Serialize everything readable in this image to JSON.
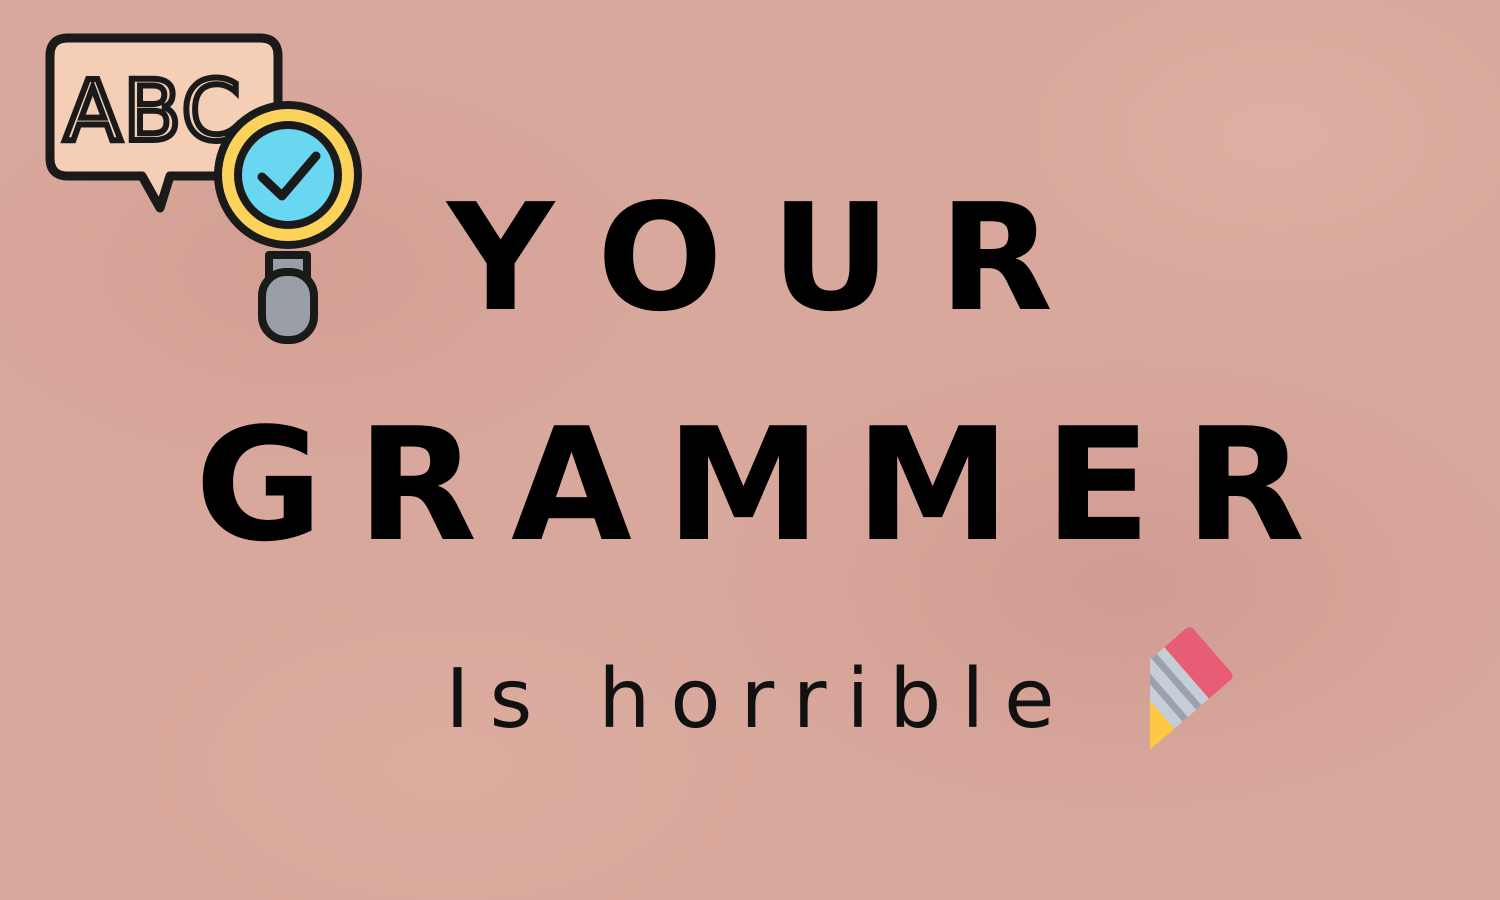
{
  "poster": {
    "line1": "YOUR",
    "line2": "GRAMMER",
    "line3": "Is horrible"
  },
  "icons": {
    "grammar_check": {
      "name": "abc-grammar-check-icon",
      "label": "ABC"
    },
    "pencil": {
      "name": "pencil-icon"
    }
  },
  "colors": {
    "background": "#d9a89c",
    "text": "#000000",
    "speech_bubble_fill": "#f4cfb6",
    "magnifier_ring": "#fcd35a",
    "magnifier_glass": "#6ad7f2",
    "magnifier_handle": "#9a9ea6",
    "pencil_body": "#ffc843",
    "pencil_eraser": "#e85d75",
    "pencil_ferrule": "#c5cdd6",
    "pencil_wood": "#d9966e",
    "pencil_tip": "#2b2b2b"
  }
}
